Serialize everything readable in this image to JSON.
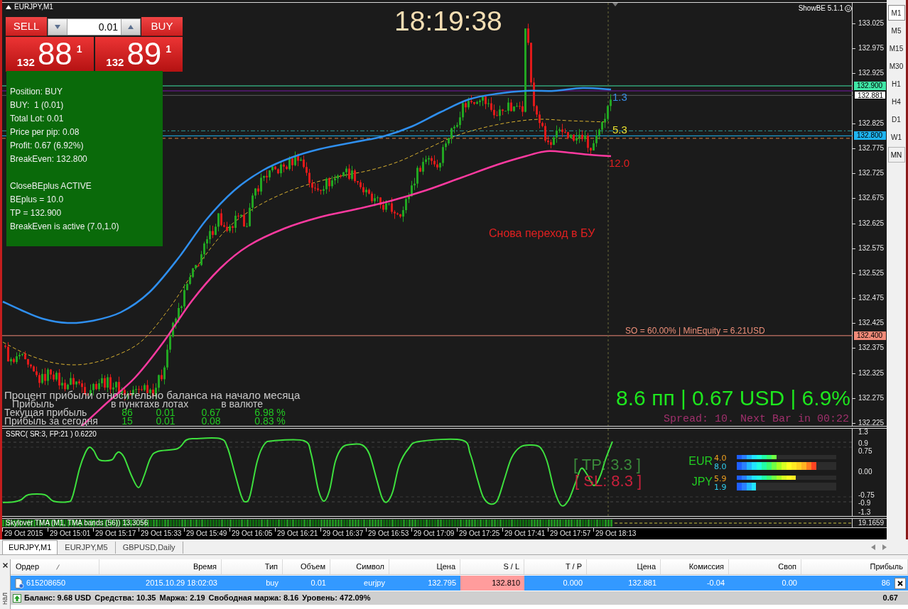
{
  "chart_window": {
    "title": "EURJPY,M1",
    "indicator_label": "ShowBE 5.1.1",
    "clock": "18:19:38",
    "trade_panel": {
      "sell_button": "SELL",
      "buy_button": "BUY",
      "lot_size": "0.01",
      "sell_price": {
        "prefix": "132",
        "main": "88",
        "point": "1"
      },
      "buy_price": {
        "prefix": "132",
        "main": "89",
        "point": "1"
      }
    },
    "info_panel": {
      "sections": [
        [
          "Position: BUY",
          "BUY:  1 (0.01)",
          "Total Lot: 0.01",
          "Price per pip: 0.08",
          "Profit: 0.67 (6.92%)",
          "BreakEven: 132.800"
        ],
        [
          "CloseBEplus ACTIVE",
          "BEplus = 10.0",
          "TP = 132.900",
          "BreakEven is active (7.0,1.0)"
        ]
      ]
    },
    "band_labels": [
      {
        "text": "1.3",
        "color": "#3a8ee6"
      },
      {
        "text": "5.3",
        "color": "#e8e030"
      },
      {
        "text": "12.0",
        "color": "#e02020"
      }
    ],
    "annotation": "Снова переход в БУ",
    "stop_out_label": "SO = 60.00% | MinEquity = 6.21USD",
    "profit_summary": "8.6 пп | 0.67 USD | 6.9%",
    "spread_label": "Spread: 10. Next Bar in 00:22",
    "stats_table": {
      "title": "Процент прибыли относительно баланса на начало месяца",
      "header": [
        "Прибыль",
        "в пунктах",
        "в лотах",
        "в валюте"
      ],
      "rows": [
        {
          "label": "Текущая прибыль",
          "values": [
            "86",
            "0.01",
            "0.67",
            "6.98 %"
          ]
        },
        {
          "label": "Прибыль за сегодня",
          "values": [
            "15",
            "0.01",
            "0.08",
            "0.83 %"
          ]
        }
      ]
    },
    "price_axis": {
      "labels": [
        "133.025",
        "132.975",
        "132.925",
        "132.825",
        "132.775",
        "132.725",
        "132.675",
        "132.625",
        "132.575",
        "132.525",
        "132.475",
        "132.425",
        "132.375",
        "132.325",
        "132.275",
        "132.225"
      ],
      "markers": [
        {
          "text": "132.900",
          "kind": "level",
          "color": "#3fe6a6"
        },
        {
          "text": "132.881",
          "kind": "bid",
          "color": "#ffffff"
        },
        {
          "text": "132.800",
          "kind": "level",
          "color": "#1eb4f0"
        },
        {
          "text": "132.400",
          "kind": "level",
          "color": "#f08a78"
        }
      ]
    }
  },
  "indicator_window": {
    "title": "SSRC( SR:3, FP:21 ) 0.6220",
    "tp_label": "[ TP: 3.3 ]",
    "sl_label": "[ SL: 8.3 ]",
    "currency_strength": [
      {
        "currency": "EUR",
        "readings": [
          {
            "value": "4.0",
            "level": 0.4
          },
          {
            "value": "8.0",
            "level": 0.8
          }
        ]
      },
      {
        "currency": "JPY",
        "readings": [
          {
            "value": "5.9",
            "level": 0.59
          },
          {
            "value": "1.9",
            "level": 0.19
          }
        ]
      }
    ],
    "scale_labels": [
      "1.3",
      "0.9",
      "0.75",
      "0.00",
      "-0.75",
      "-0.9",
      "-1.3"
    ]
  },
  "tma_window": {
    "title": "Skylover TMA (M1, TMA bands (56)) 13.3056",
    "scale_label": "19.1659"
  },
  "time_axis": [
    "29 Oct 2015",
    "29 Oct 15:01",
    "29 Oct 15:17",
    "29 Oct 15:33",
    "29 Oct 15:49",
    "29 Oct 16:05",
    "29 Oct 16:21",
    "29 Oct 16:37",
    "29 Oct 16:53",
    "29 Oct 17:09",
    "29 Oct 17:25",
    "29 Oct 17:41",
    "29 Oct 17:57",
    "29 Oct 18:13"
  ],
  "timeframes": [
    {
      "label": "M1",
      "selected": true,
      "hovered": false
    },
    {
      "label": "M5",
      "selected": false,
      "hovered": false
    },
    {
      "label": "M15",
      "selected": false,
      "hovered": false
    },
    {
      "label": "M30",
      "selected": false,
      "hovered": false
    },
    {
      "label": "H1",
      "selected": false,
      "hovered": false
    },
    {
      "label": "H4",
      "selected": false,
      "hovered": false
    },
    {
      "label": "D1",
      "selected": false,
      "hovered": false
    },
    {
      "label": "W1",
      "selected": false,
      "hovered": false
    },
    {
      "label": "MN",
      "selected": false,
      "hovered": true
    }
  ],
  "chart_tabs": [
    {
      "label": "EURJPY,M1",
      "selected": true
    },
    {
      "label": "EURJPY,M5",
      "selected": false
    },
    {
      "label": "GBPUSD,Daily",
      "selected": false
    }
  ],
  "terminal": {
    "side_label": "нал",
    "columns": [
      "Ордер",
      "Время",
      "Тип",
      "Объем",
      "Символ",
      "Цена",
      "S / L",
      "T / P",
      "Цена",
      "Комиссия",
      "Своп",
      "Прибыль"
    ],
    "rows": [
      {
        "selected": true,
        "sl_alert": true,
        "cells": [
          "615208650",
          "2015.10.29 18:02:03",
          "buy",
          "0.01",
          "eurjpy",
          "132.795",
          "132.810",
          "0.000",
          "132.881",
          "-0.04",
          "0.00",
          "86"
        ]
      }
    ],
    "summary": {
      "items": [
        "Баланс: 9.68 USD",
        "Средства: 10.35",
        "Маржа: 2.19",
        "Свободная маржа: 8.16",
        "Уровень: 472.09%"
      ],
      "total": "0.67"
    }
  }
}
